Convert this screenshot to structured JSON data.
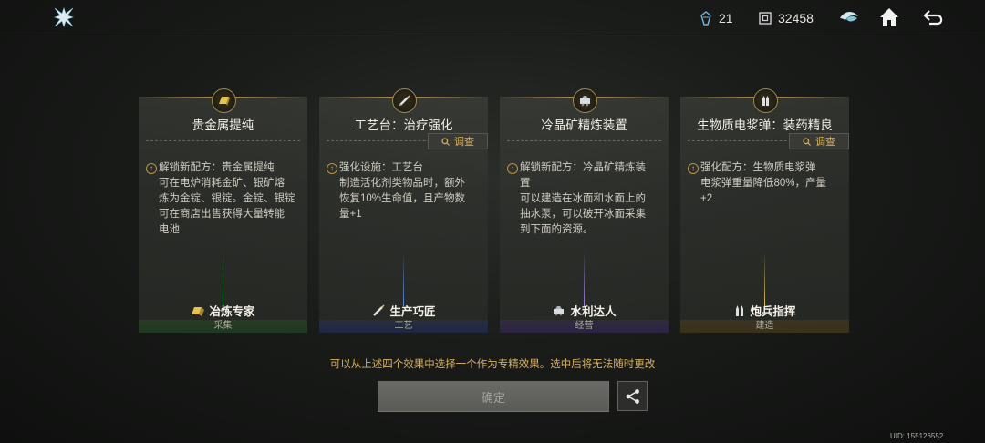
{
  "header": {
    "logo_icon": "shuriken-logo-icon",
    "crystals": "21",
    "coins": "32458",
    "icons": [
      "eye-icon",
      "home-icon",
      "back-icon"
    ]
  },
  "cards": [
    {
      "title": "贵金属提纯",
      "badge_icon": "ingot-icon",
      "has_investigate": false,
      "lines": [
        "解锁新配方：贵金属提纯",
        "可在电炉消耗金矿、银矿熔",
        "炼为金锭、银锭。金锭、银锭",
        "可在商店出售获得大量转能",
        "电池"
      ],
      "tag": "冶炼专家",
      "tag_icon": "ingot-icon",
      "footer": "采集",
      "glow_color": "#4bd06a"
    },
    {
      "title": "工艺台：治疗强化",
      "badge_icon": "syringe-icon",
      "has_investigate": true,
      "investigate_label": "调查",
      "lines": [
        "强化设施：工艺台",
        "制造活化剂类物品时，额外",
        "恢复10%生命值，且产物数",
        "量+1"
      ],
      "tag": "生产巧匠",
      "tag_icon": "syringe-icon",
      "footer": "工艺",
      "glow_color": "#5a8ee0"
    },
    {
      "title": "冷晶矿精炼装置",
      "badge_icon": "crystal-cart-icon",
      "has_investigate": false,
      "lines": [
        "解锁新配方：冷晶矿精炼装",
        "置",
        "可以建造在冰面和水面上的",
        "抽水泵，可以破开冰面采集",
        "到下面的资源。"
      ],
      "tag": "水利达人",
      "tag_icon": "crystal-cart-icon",
      "footer": "经营",
      "glow_color": "#9a7ee0"
    },
    {
      "title": "生物质电浆弹：装药精良",
      "badge_icon": "shells-icon",
      "has_investigate": true,
      "investigate_label": "调查",
      "lines": [
        "强化配方：生物质电浆弹",
        "电浆弹重量降低80%，产量",
        "+2"
      ],
      "tag": "炮兵指挥",
      "tag_icon": "shells-icon",
      "footer": "建造",
      "glow_color": "#e0c050"
    }
  ],
  "notice": "可以从上述四个效果中选择一个作为专精效果。选中后将无法随时更改",
  "confirm_label": "确定",
  "uid": "UID: 155126552"
}
